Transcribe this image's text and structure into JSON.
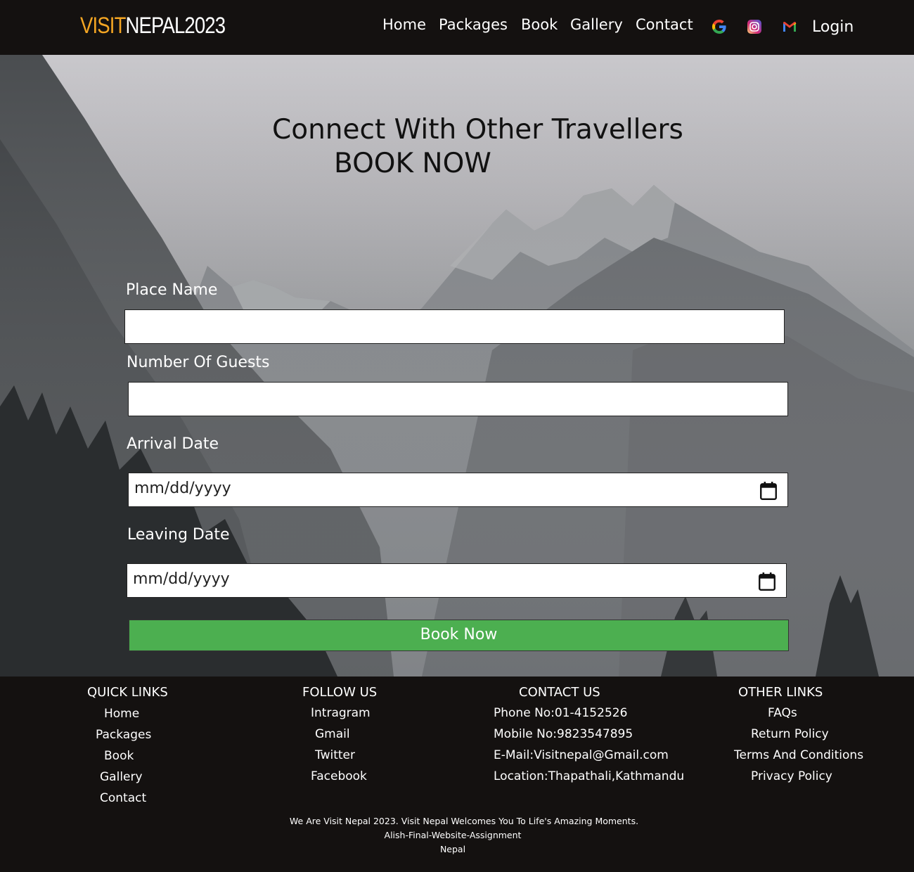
{
  "nav": {
    "logo_part1": "VISIT",
    "logo_part2": "NEPAL2023",
    "links": [
      "Home",
      "Packages",
      "Book",
      "Gallery",
      "Contact"
    ],
    "social_icons": [
      "google-icon",
      "instagram-icon",
      "gmail-icon"
    ],
    "login": "Login"
  },
  "hero": {
    "title_line1": "Connect With Other Travellers",
    "title_line2": "BOOK NOW"
  },
  "form": {
    "place_label": "Place Name",
    "place_value": "",
    "guests_label": "Number Of Guests",
    "guests_value": "",
    "arrival_label": "Arrival Date",
    "arrival_value": "mm/dd/yyyy",
    "leaving_label": "Leaving Date",
    "leaving_value": "mm/dd/yyyy",
    "submit_label": "Book Now"
  },
  "footer": {
    "quick_links": {
      "heading": "QUICK LINKS",
      "items": [
        "Home",
        "Packages",
        "Book",
        "Gallery",
        "Contact"
      ]
    },
    "follow_us": {
      "heading": "FOLLOW US",
      "items": [
        "Intragram",
        "Gmail",
        "Twitter",
        "Facebook"
      ]
    },
    "contact_us": {
      "heading": "CONTACT US",
      "items": [
        "Phone No:01-4152526",
        "Mobile No:9823547895",
        "E-Mail:Visitnepal@Gmail.com",
        "Location:Thapathali,Kathmandu"
      ]
    },
    "other_links": {
      "heading": "OTHER LINKS",
      "items": [
        "FAQs",
        "Return Policy",
        "Terms And Conditions",
        "Privacy Policy"
      ]
    },
    "bottom_lines": [
      "We Are Visit Nepal 2023. Visit Nepal Welcomes You To Life's Amazing Moments.",
      "Alish-Final-Website-Assignment",
      "Nepal"
    ]
  },
  "colors": {
    "accent_logo": "#f5a623",
    "button_green": "#4caf50",
    "dark_bg": "#141110"
  }
}
